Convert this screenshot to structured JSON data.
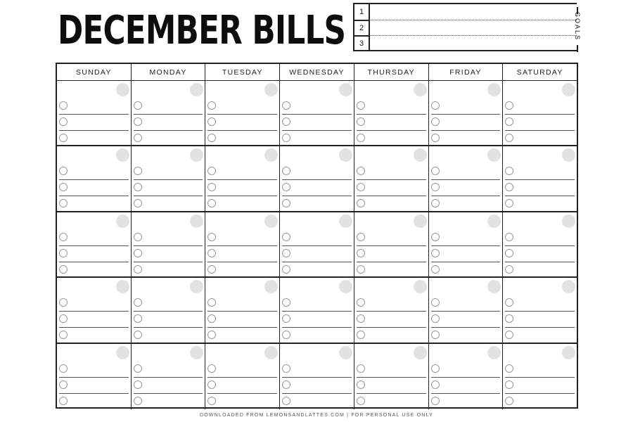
{
  "title": "DECEMBER BILLS",
  "goals": {
    "label": "GOALS",
    "items": [
      {
        "number": "1",
        "text": ""
      },
      {
        "number": "2",
        "text": ""
      },
      {
        "number": "3",
        "text": ""
      }
    ]
  },
  "calendar": {
    "weekdays": [
      "SUNDAY",
      "MONDAY",
      "TUESDAY",
      "WEDNESDAY",
      "THURSDAY",
      "FRIDAY",
      "SATURDAY"
    ],
    "weeks": 5,
    "checklist_lines_per_day": 3,
    "day_dot_color": "#e2e2e2"
  },
  "footer": "DOWNLOADED FROM LEMONSANDLATTES.COM | FOR PERSONAL USE ONLY"
}
